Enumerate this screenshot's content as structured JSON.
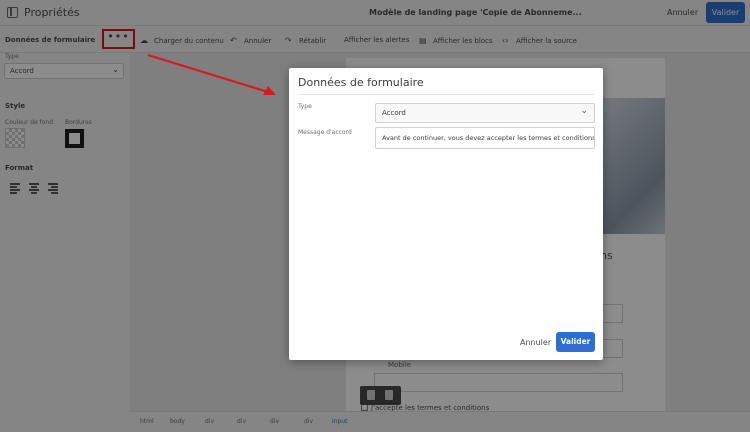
{
  "topbar": {
    "properties_label": "Propriétés",
    "document_title": "Modèle de landing page 'Copie de Abonneme...",
    "cancel_label": "Annuler",
    "validate_label": "Valider"
  },
  "toolbar": {
    "section_label": "Données de formulaire",
    "more_label": "•••",
    "items": [
      {
        "label": "Charger du contenu",
        "icon": "cloud-upload-icon"
      },
      {
        "label": "Annuler",
        "icon": "undo-icon"
      },
      {
        "label": "Rétablir",
        "icon": "redo-icon"
      },
      {
        "label": "Afficher les alertes",
        "icon": ""
      },
      {
        "label": "Afficher les blocs",
        "icon": "blocks-icon"
      },
      {
        "label": "Afficher la source",
        "icon": "code-icon"
      }
    ]
  },
  "sidebar": {
    "type_label": "Type",
    "type_value": "Accord",
    "style_label": "Style",
    "background_label": "Couleur de fond",
    "borders_label": "Bordures",
    "format_label": "Format"
  },
  "preview": {
    "heading_fragment": "ns",
    "mobile_label": "Mobile",
    "checkbox_label": "J'accepte les termes et conditions"
  },
  "statusbar": {
    "crumbs": [
      "html",
      "body",
      "div",
      "div",
      "div",
      "div",
      "input"
    ]
  },
  "modal": {
    "title": "Données de formulaire",
    "type_label": "Type",
    "type_value": "Accord",
    "message_label": "Message d'accord",
    "message_value": "Avant de continuer, vous devez accepter les termes et conditions.",
    "cancel_label": "Annuler",
    "validate_label": "Valider"
  },
  "colors": {
    "accent": "#2d6fd0",
    "annotation": "#d9191b"
  }
}
